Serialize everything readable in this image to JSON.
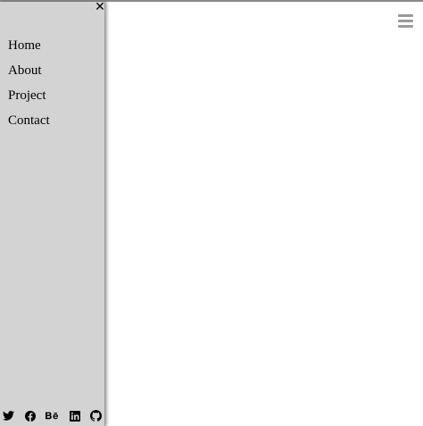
{
  "sidebar": {
    "close_icon": "close-icon",
    "items": [
      {
        "label": "Home"
      },
      {
        "label": "About"
      },
      {
        "label": "Project"
      },
      {
        "label": "Contact"
      }
    ],
    "social": [
      "twitter-icon",
      "facebook-icon",
      "behance-icon",
      "linkedin-icon",
      "github-icon"
    ]
  },
  "header": {
    "menu_icon": "hamburger-menu-icon"
  },
  "colors": {
    "sidebar_bg": "#d3d3d3",
    "menu_icon": "#9a9a9a",
    "page_bg": "#ffffff"
  }
}
